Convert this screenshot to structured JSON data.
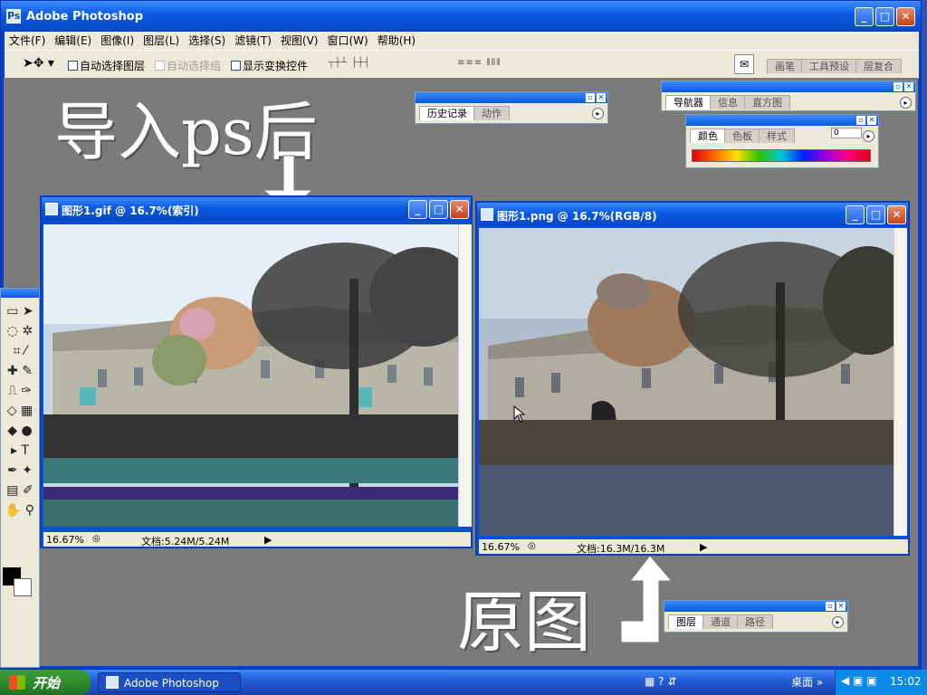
{
  "app": {
    "title": "Adobe Photoshop",
    "icon": "photoshop-icon"
  },
  "menu": [
    "文件(F)",
    "编辑(E)",
    "图像(I)",
    "图层(L)",
    "选择(S)",
    "滤镜(T)",
    "视图(V)",
    "窗口(W)",
    "帮助(H)"
  ],
  "options": {
    "auto_select_layer": "自动选择图层",
    "auto_select_group": "自动选择组",
    "show_transform": "显示变换控件",
    "brush_tabs": [
      "画笔",
      "工具预设",
      "层复合"
    ]
  },
  "annotations": {
    "top": "导入ps后",
    "bottom": "原图"
  },
  "panels": {
    "history": {
      "tabs": [
        "历史记录",
        "动作"
      ]
    },
    "navigator": {
      "tabs": [
        "导航器",
        "信息",
        "直方图"
      ]
    },
    "color": {
      "tabs": [
        "颜色",
        "色板",
        "样式"
      ],
      "value": "0"
    },
    "layers": {
      "tabs": [
        "图层",
        "通道",
        "路径"
      ]
    }
  },
  "documents": [
    {
      "title": "图形1.gif @ 16.7%(索引)",
      "zoom": "16.67%",
      "doc": "文档:5.24M/5.24M"
    },
    {
      "title": "图形1.png @ 16.7%(RGB/8)",
      "zoom": "16.67%",
      "doc": "文档:16.3M/16.3M"
    }
  ],
  "taskbar": {
    "start": "开始",
    "app_button": "Adobe Photoshop",
    "desktop": "桌面",
    "time": "15:02"
  }
}
